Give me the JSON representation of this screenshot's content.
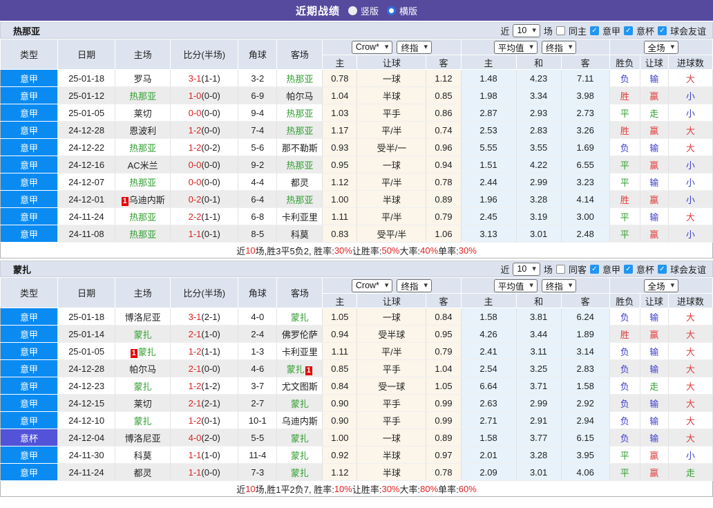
{
  "titlebar": {
    "title": "近期战绩",
    "vertical_label": "竖版",
    "horizontal_label": "横版"
  },
  "table_header": {
    "cols": [
      "类型",
      "日期",
      "主场",
      "比分(半场)",
      "角球",
      "客场"
    ],
    "selects": {
      "bookmaker": "Crow*",
      "final1": "终指",
      "average": "平均值",
      "final2": "终指",
      "fulltime": "全场"
    },
    "sub": [
      "主",
      "让球",
      "客",
      "主",
      "和",
      "客",
      "胜负",
      "让球",
      "进球数"
    ]
  },
  "colors": {
    "titlebar_purple": "#564a9e",
    "league_blue": "#0a8bf2",
    "cup_purple": "#5253d8",
    "team_green": "#2f9e2f",
    "score_red": "#e22020",
    "win_red": "#e23b3b",
    "lose_blue": "#3e3ecd",
    "draw_green": "#2f9e2f",
    "checkbox_blue": "#2196f3"
  },
  "sections": [
    {
      "team": "热那亚",
      "controls": {
        "near": "近",
        "count": "10",
        "games": "场",
        "same": "同主",
        "filters": [
          "意甲",
          "意杯",
          "球会友谊"
        ]
      },
      "rows": [
        {
          "type": "意甲",
          "cup": false,
          "date": "25-01-18",
          "home": {
            "n": "罗马"
          },
          "score": "3-1",
          "half": "(1-1)",
          "corner": "3-2",
          "away": {
            "n": "热那亚",
            "g": 1
          },
          "crow": [
            "0.78",
            "一球",
            "1.12"
          ],
          "avg": [
            "1.48",
            "4.23",
            "7.11"
          ],
          "res": [
            [
              "负",
              "b"
            ],
            [
              "输",
              "b"
            ],
            [
              "大",
              "r"
            ]
          ]
        },
        {
          "type": "意甲",
          "cup": false,
          "date": "25-01-12",
          "home": {
            "n": "热那亚",
            "g": 1
          },
          "score": "1-0",
          "half": "(0-0)",
          "corner": "6-9",
          "away": {
            "n": "帕尔马"
          },
          "crow": [
            "1.04",
            "半球",
            "0.85"
          ],
          "avg": [
            "1.98",
            "3.34",
            "3.98"
          ],
          "res": [
            [
              "胜",
              "r"
            ],
            [
              "赢",
              "r"
            ],
            [
              "小",
              "b"
            ]
          ]
        },
        {
          "type": "意甲",
          "cup": false,
          "date": "25-01-05",
          "home": {
            "n": "莱切"
          },
          "score": "0-0",
          "half": "(0-0)",
          "corner": "9-4",
          "away": {
            "n": "热那亚",
            "g": 1
          },
          "crow": [
            "1.03",
            "平手",
            "0.86"
          ],
          "avg": [
            "2.87",
            "2.93",
            "2.73"
          ],
          "res": [
            [
              "平",
              "g"
            ],
            [
              "走",
              "g"
            ],
            [
              "小",
              "b"
            ]
          ]
        },
        {
          "type": "意甲",
          "cup": false,
          "date": "24-12-28",
          "home": {
            "n": "恩波利"
          },
          "score": "1-2",
          "half": "(0-0)",
          "corner": "7-4",
          "away": {
            "n": "热那亚",
            "g": 1
          },
          "crow": [
            "1.17",
            "平/半",
            "0.74"
          ],
          "avg": [
            "2.53",
            "2.83",
            "3.26"
          ],
          "res": [
            [
              "胜",
              "r"
            ],
            [
              "赢",
              "r"
            ],
            [
              "大",
              "r"
            ]
          ]
        },
        {
          "type": "意甲",
          "cup": false,
          "date": "24-12-22",
          "home": {
            "n": "热那亚",
            "g": 1
          },
          "score": "1-2",
          "half": "(0-2)",
          "corner": "5-6",
          "away": {
            "n": "那不勒斯"
          },
          "crow": [
            "0.93",
            "受半/一",
            "0.96"
          ],
          "avg": [
            "5.55",
            "3.55",
            "1.69"
          ],
          "res": [
            [
              "负",
              "b"
            ],
            [
              "输",
              "b"
            ],
            [
              "大",
              "r"
            ]
          ]
        },
        {
          "type": "意甲",
          "cup": false,
          "date": "24-12-16",
          "home": {
            "n": "AC米兰"
          },
          "score": "0-0",
          "half": "(0-0)",
          "corner": "9-2",
          "away": {
            "n": "热那亚",
            "g": 1
          },
          "crow": [
            "0.95",
            "一球",
            "0.94"
          ],
          "avg": [
            "1.51",
            "4.22",
            "6.55"
          ],
          "res": [
            [
              "平",
              "g"
            ],
            [
              "赢",
              "r"
            ],
            [
              "小",
              "b"
            ]
          ]
        },
        {
          "type": "意甲",
          "cup": false,
          "date": "24-12-07",
          "home": {
            "n": "热那亚",
            "g": 1
          },
          "score": "0-0",
          "half": "(0-0)",
          "corner": "4-4",
          "away": {
            "n": "都灵"
          },
          "crow": [
            "1.12",
            "平/半",
            "0.78"
          ],
          "avg": [
            "2.44",
            "2.99",
            "3.23"
          ],
          "res": [
            [
              "平",
              "g"
            ],
            [
              "输",
              "b"
            ],
            [
              "小",
              "b"
            ]
          ]
        },
        {
          "type": "意甲",
          "cup": false,
          "date": "24-12-01",
          "home": {
            "n": "乌迪内斯",
            "rc": "pre"
          },
          "score": "0-2",
          "half": "(0-1)",
          "corner": "6-4",
          "away": {
            "n": "热那亚",
            "g": 1
          },
          "crow": [
            "1.00",
            "半球",
            "0.89"
          ],
          "avg": [
            "1.96",
            "3.28",
            "4.14"
          ],
          "res": [
            [
              "胜",
              "r"
            ],
            [
              "赢",
              "r"
            ],
            [
              "小",
              "b"
            ]
          ]
        },
        {
          "type": "意甲",
          "cup": false,
          "date": "24-11-24",
          "home": {
            "n": "热那亚",
            "g": 1
          },
          "score": "2-2",
          "half": "(1-1)",
          "corner": "6-8",
          "away": {
            "n": "卡利亚里"
          },
          "crow": [
            "1.11",
            "平/半",
            "0.79"
          ],
          "avg": [
            "2.45",
            "3.19",
            "3.00"
          ],
          "res": [
            [
              "平",
              "g"
            ],
            [
              "输",
              "b"
            ],
            [
              "大",
              "r"
            ]
          ]
        },
        {
          "type": "意甲",
          "cup": false,
          "date": "24-11-08",
          "home": {
            "n": "热那亚",
            "g": 1
          },
          "score": "1-1",
          "half": "(0-1)",
          "corner": "8-5",
          "away": {
            "n": "科莫"
          },
          "crow": [
            "0.83",
            "受平/半",
            "1.06"
          ],
          "avg": [
            "3.13",
            "3.01",
            "2.48"
          ],
          "res": [
            [
              "平",
              "g"
            ],
            [
              "赢",
              "r"
            ],
            [
              "小",
              "b"
            ]
          ]
        }
      ],
      "summary": [
        {
          "t": "近"
        },
        {
          "t": "10",
          "red": true
        },
        {
          "t": "场,胜3平5负2, 胜率:"
        },
        {
          "t": "30%",
          "red": true
        },
        {
          "t": " 让胜率:"
        },
        {
          "t": "50%",
          "red": true
        },
        {
          "t": " 大率:"
        },
        {
          "t": "40%",
          "red": true
        },
        {
          "t": " 单率:"
        },
        {
          "t": "30%",
          "red": true
        }
      ]
    },
    {
      "team": "蒙扎",
      "controls": {
        "near": "近",
        "count": "10",
        "games": "场",
        "same": "同客",
        "filters": [
          "意甲",
          "意杯",
          "球会友谊"
        ]
      },
      "rows": [
        {
          "type": "意甲",
          "cup": false,
          "date": "25-01-18",
          "home": {
            "n": "博洛尼亚"
          },
          "score": "3-1",
          "half": "(2-1)",
          "corner": "4-0",
          "away": {
            "n": "蒙扎",
            "g": 1
          },
          "crow": [
            "1.05",
            "一球",
            "0.84"
          ],
          "avg": [
            "1.58",
            "3.81",
            "6.24"
          ],
          "res": [
            [
              "负",
              "b"
            ],
            [
              "输",
              "b"
            ],
            [
              "大",
              "r"
            ]
          ]
        },
        {
          "type": "意甲",
          "cup": false,
          "date": "25-01-14",
          "home": {
            "n": "蒙扎",
            "g": 1
          },
          "score": "2-1",
          "half": "(1-0)",
          "corner": "2-4",
          "away": {
            "n": "佛罗伦萨"
          },
          "crow": [
            "0.94",
            "受半球",
            "0.95"
          ],
          "avg": [
            "4.26",
            "3.44",
            "1.89"
          ],
          "res": [
            [
              "胜",
              "r"
            ],
            [
              "赢",
              "r"
            ],
            [
              "大",
              "r"
            ]
          ]
        },
        {
          "type": "意甲",
          "cup": false,
          "date": "25-01-05",
          "home": {
            "n": "蒙扎",
            "g": 1,
            "rc": "pre"
          },
          "score": "1-2",
          "half": "(1-1)",
          "corner": "1-3",
          "away": {
            "n": "卡利亚里"
          },
          "crow": [
            "1.11",
            "平/半",
            "0.79"
          ],
          "avg": [
            "2.41",
            "3.11",
            "3.14"
          ],
          "res": [
            [
              "负",
              "b"
            ],
            [
              "输",
              "b"
            ],
            [
              "大",
              "r"
            ]
          ]
        },
        {
          "type": "意甲",
          "cup": false,
          "date": "24-12-28",
          "home": {
            "n": "帕尔马"
          },
          "score": "2-1",
          "half": "(0-0)",
          "corner": "4-6",
          "away": {
            "n": "蒙扎",
            "g": 1,
            "rc": "post"
          },
          "crow": [
            "0.85",
            "平手",
            "1.04"
          ],
          "avg": [
            "2.54",
            "3.25",
            "2.83"
          ],
          "res": [
            [
              "负",
              "b"
            ],
            [
              "输",
              "b"
            ],
            [
              "大",
              "r"
            ]
          ]
        },
        {
          "type": "意甲",
          "cup": false,
          "date": "24-12-23",
          "home": {
            "n": "蒙扎",
            "g": 1
          },
          "score": "1-2",
          "half": "(1-2)",
          "corner": "3-7",
          "away": {
            "n": "尤文图斯"
          },
          "crow": [
            "0.84",
            "受一球",
            "1.05"
          ],
          "avg": [
            "6.64",
            "3.71",
            "1.58"
          ],
          "res": [
            [
              "负",
              "b"
            ],
            [
              "走",
              "g"
            ],
            [
              "大",
              "r"
            ]
          ]
        },
        {
          "type": "意甲",
          "cup": false,
          "date": "24-12-15",
          "home": {
            "n": "莱切"
          },
          "score": "2-1",
          "half": "(2-1)",
          "corner": "2-7",
          "away": {
            "n": "蒙扎",
            "g": 1
          },
          "crow": [
            "0.90",
            "平手",
            "0.99"
          ],
          "avg": [
            "2.63",
            "2.99",
            "2.92"
          ],
          "res": [
            [
              "负",
              "b"
            ],
            [
              "输",
              "b"
            ],
            [
              "大",
              "r"
            ]
          ]
        },
        {
          "type": "意甲",
          "cup": false,
          "date": "24-12-10",
          "home": {
            "n": "蒙扎",
            "g": 1
          },
          "score": "1-2",
          "half": "(0-1)",
          "corner": "10-1",
          "away": {
            "n": "乌迪内斯"
          },
          "crow": [
            "0.90",
            "平手",
            "0.99"
          ],
          "avg": [
            "2.71",
            "2.91",
            "2.94"
          ],
          "res": [
            [
              "负",
              "b"
            ],
            [
              "输",
              "b"
            ],
            [
              "大",
              "r"
            ]
          ]
        },
        {
          "type": "意杯",
          "cup": true,
          "date": "24-12-04",
          "home": {
            "n": "博洛尼亚"
          },
          "score": "4-0",
          "half": "(2-0)",
          "corner": "5-5",
          "away": {
            "n": "蒙扎",
            "g": 1
          },
          "crow": [
            "1.00",
            "一球",
            "0.89"
          ],
          "avg": [
            "1.58",
            "3.77",
            "6.15"
          ],
          "res": [
            [
              "负",
              "b"
            ],
            [
              "输",
              "b"
            ],
            [
              "大",
              "r"
            ]
          ]
        },
        {
          "type": "意甲",
          "cup": false,
          "date": "24-11-30",
          "home": {
            "n": "科莫"
          },
          "score": "1-1",
          "half": "(1-0)",
          "corner": "11-4",
          "away": {
            "n": "蒙扎",
            "g": 1
          },
          "crow": [
            "0.92",
            "半球",
            "0.97"
          ],
          "avg": [
            "2.01",
            "3.28",
            "3.95"
          ],
          "res": [
            [
              "平",
              "g"
            ],
            [
              "赢",
              "r"
            ],
            [
              "小",
              "b"
            ]
          ]
        },
        {
          "type": "意甲",
          "cup": false,
          "date": "24-11-24",
          "home": {
            "n": "都灵"
          },
          "score": "1-1",
          "half": "(0-0)",
          "corner": "7-3",
          "away": {
            "n": "蒙扎",
            "g": 1
          },
          "crow": [
            "1.12",
            "半球",
            "0.78"
          ],
          "avg": [
            "2.09",
            "3.01",
            "4.06"
          ],
          "res": [
            [
              "平",
              "g"
            ],
            [
              "赢",
              "r"
            ],
            [
              "走",
              "g"
            ]
          ]
        }
      ],
      "summary": [
        {
          "t": "近"
        },
        {
          "t": "10",
          "red": true
        },
        {
          "t": "场,胜1平2负7, 胜率:"
        },
        {
          "t": "10%",
          "red": true
        },
        {
          "t": " 让胜率:"
        },
        {
          "t": "30%",
          "red": true
        },
        {
          "t": " 大率:"
        },
        {
          "t": "80%",
          "red": true
        },
        {
          "t": " 单率:"
        },
        {
          "t": "60%",
          "red": true
        }
      ]
    }
  ]
}
